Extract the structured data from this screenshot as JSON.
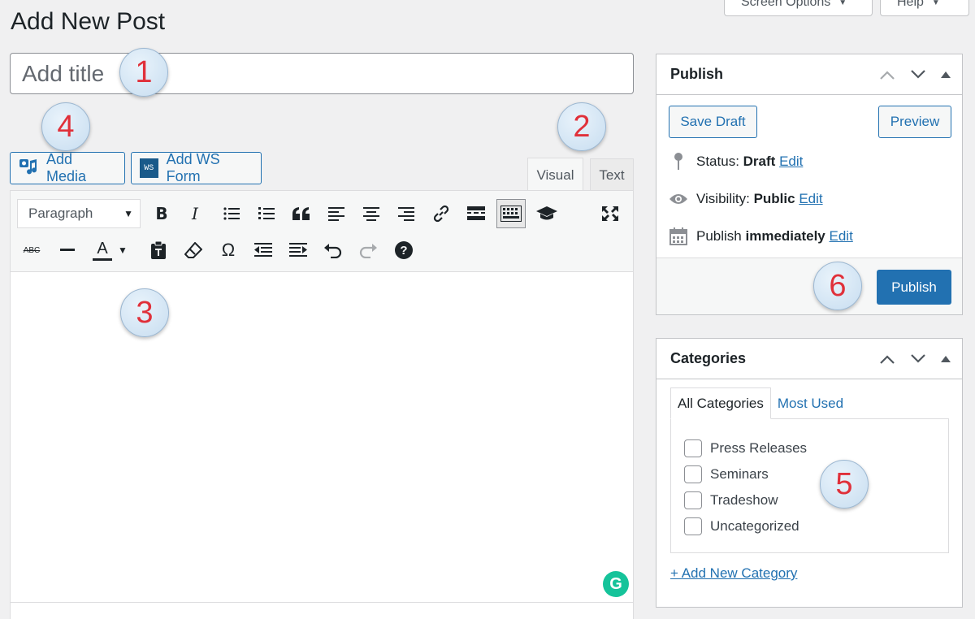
{
  "header": {
    "page_title": "Add New Post",
    "screen_options_label": "Screen Options",
    "help_label": "Help"
  },
  "editor": {
    "title_placeholder": "Add title",
    "add_media_label": "Add Media",
    "ws_logo_text": "WS",
    "add_ws_form_label": "Add WS Form",
    "tab_visual": "Visual",
    "tab_text": "Text",
    "format_select_value": "Paragraph",
    "toolbar_row1": [
      "bold-icon",
      "italic-icon",
      "bullet-list-icon",
      "numbered-list-icon",
      "blockquote-icon",
      "align-left-icon",
      "align-center-icon",
      "align-right-icon",
      "link-icon",
      "read-more-icon",
      "toolbar-toggle-icon",
      "graduation-cap-icon",
      "fullscreen-icon"
    ],
    "toolbar_row2": [
      "strikethrough-icon",
      "horizontal-line-icon",
      "text-color-icon",
      "paste-text-icon",
      "clear-formatting-icon",
      "special-character-icon",
      "outdent-icon",
      "indent-icon",
      "undo-icon",
      "redo-icon",
      "help-icon"
    ],
    "bold_glyph": "B",
    "italic_glyph": "I",
    "strike_glyph": "ABC",
    "text_color_glyph": "A",
    "omega_glyph": "Ω",
    "help_glyph": "?",
    "grammarly_glyph": "G"
  },
  "markers": [
    "1",
    "2",
    "3",
    "4",
    "5",
    "6"
  ],
  "publish": {
    "heading": "Publish",
    "save_draft_label": "Save Draft",
    "preview_label": "Preview",
    "status_label": "Status:",
    "status_value": "Draft",
    "visibility_label": "Visibility:",
    "visibility_value": "Public",
    "schedule_label": "Publish",
    "schedule_value": "immediately",
    "edit_link": "Edit",
    "publish_button_label": "Publish"
  },
  "categories": {
    "heading": "Categories",
    "tab_all": "All Categories",
    "tab_most_used": "Most Used",
    "items": [
      "Press Releases",
      "Seminars",
      "Tradeshow",
      "Uncategorized"
    ],
    "add_new_label": "+ Add New Category"
  },
  "colors": {
    "accent": "#2271b1",
    "marker_number": "#e0303a",
    "grammarly": "#15c39a"
  }
}
